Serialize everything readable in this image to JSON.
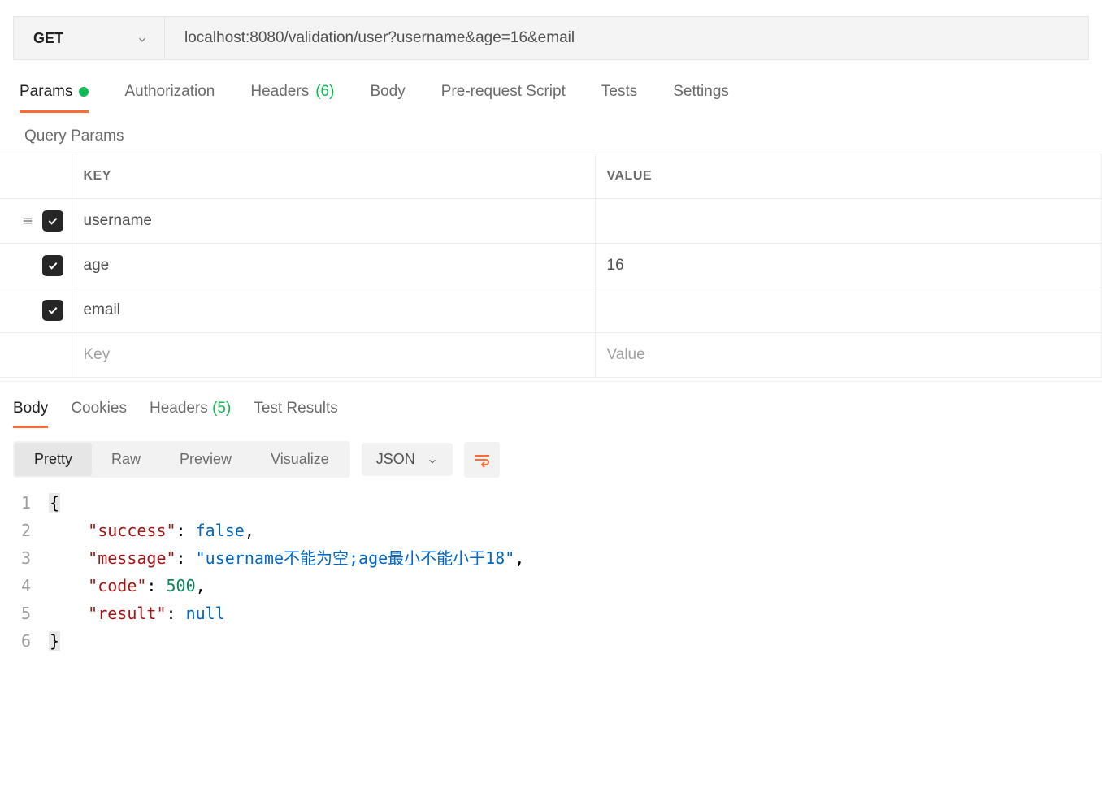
{
  "request": {
    "method": "GET",
    "url": "localhost:8080/validation/user?username&age=16&email"
  },
  "reqTabs": {
    "params": "Params",
    "authorization": "Authorization",
    "headers": "Headers",
    "headersCount": "(6)",
    "body": "Body",
    "prerequest": "Pre-request Script",
    "tests": "Tests",
    "settings": "Settings"
  },
  "querySection": {
    "heading": "Query Params",
    "colKey": "KEY",
    "colValue": "VALUE",
    "keyPlaceholder": "Key",
    "valuePlaceholder": "Value",
    "rows": [
      {
        "key": "username",
        "value": ""
      },
      {
        "key": "age",
        "value": "16"
      },
      {
        "key": "email",
        "value": ""
      }
    ]
  },
  "respTabs": {
    "body": "Body",
    "cookies": "Cookies",
    "headers": "Headers",
    "headersCount": "(5)",
    "testResults": "Test Results"
  },
  "respView": {
    "pretty": "Pretty",
    "raw": "Raw",
    "preview": "Preview",
    "visualize": "Visualize",
    "format": "JSON"
  },
  "responseBody": {
    "lines": [
      "1",
      "2",
      "3",
      "4",
      "5",
      "6"
    ],
    "key_success": "\"success\"",
    "val_success": "false",
    "key_message": "\"message\"",
    "val_message": "\"username不能为空;age最小不能小于18\"",
    "key_code": "\"code\"",
    "val_code": "500",
    "key_result": "\"result\"",
    "val_result": "null",
    "brace_open": "{",
    "brace_close": "}"
  }
}
